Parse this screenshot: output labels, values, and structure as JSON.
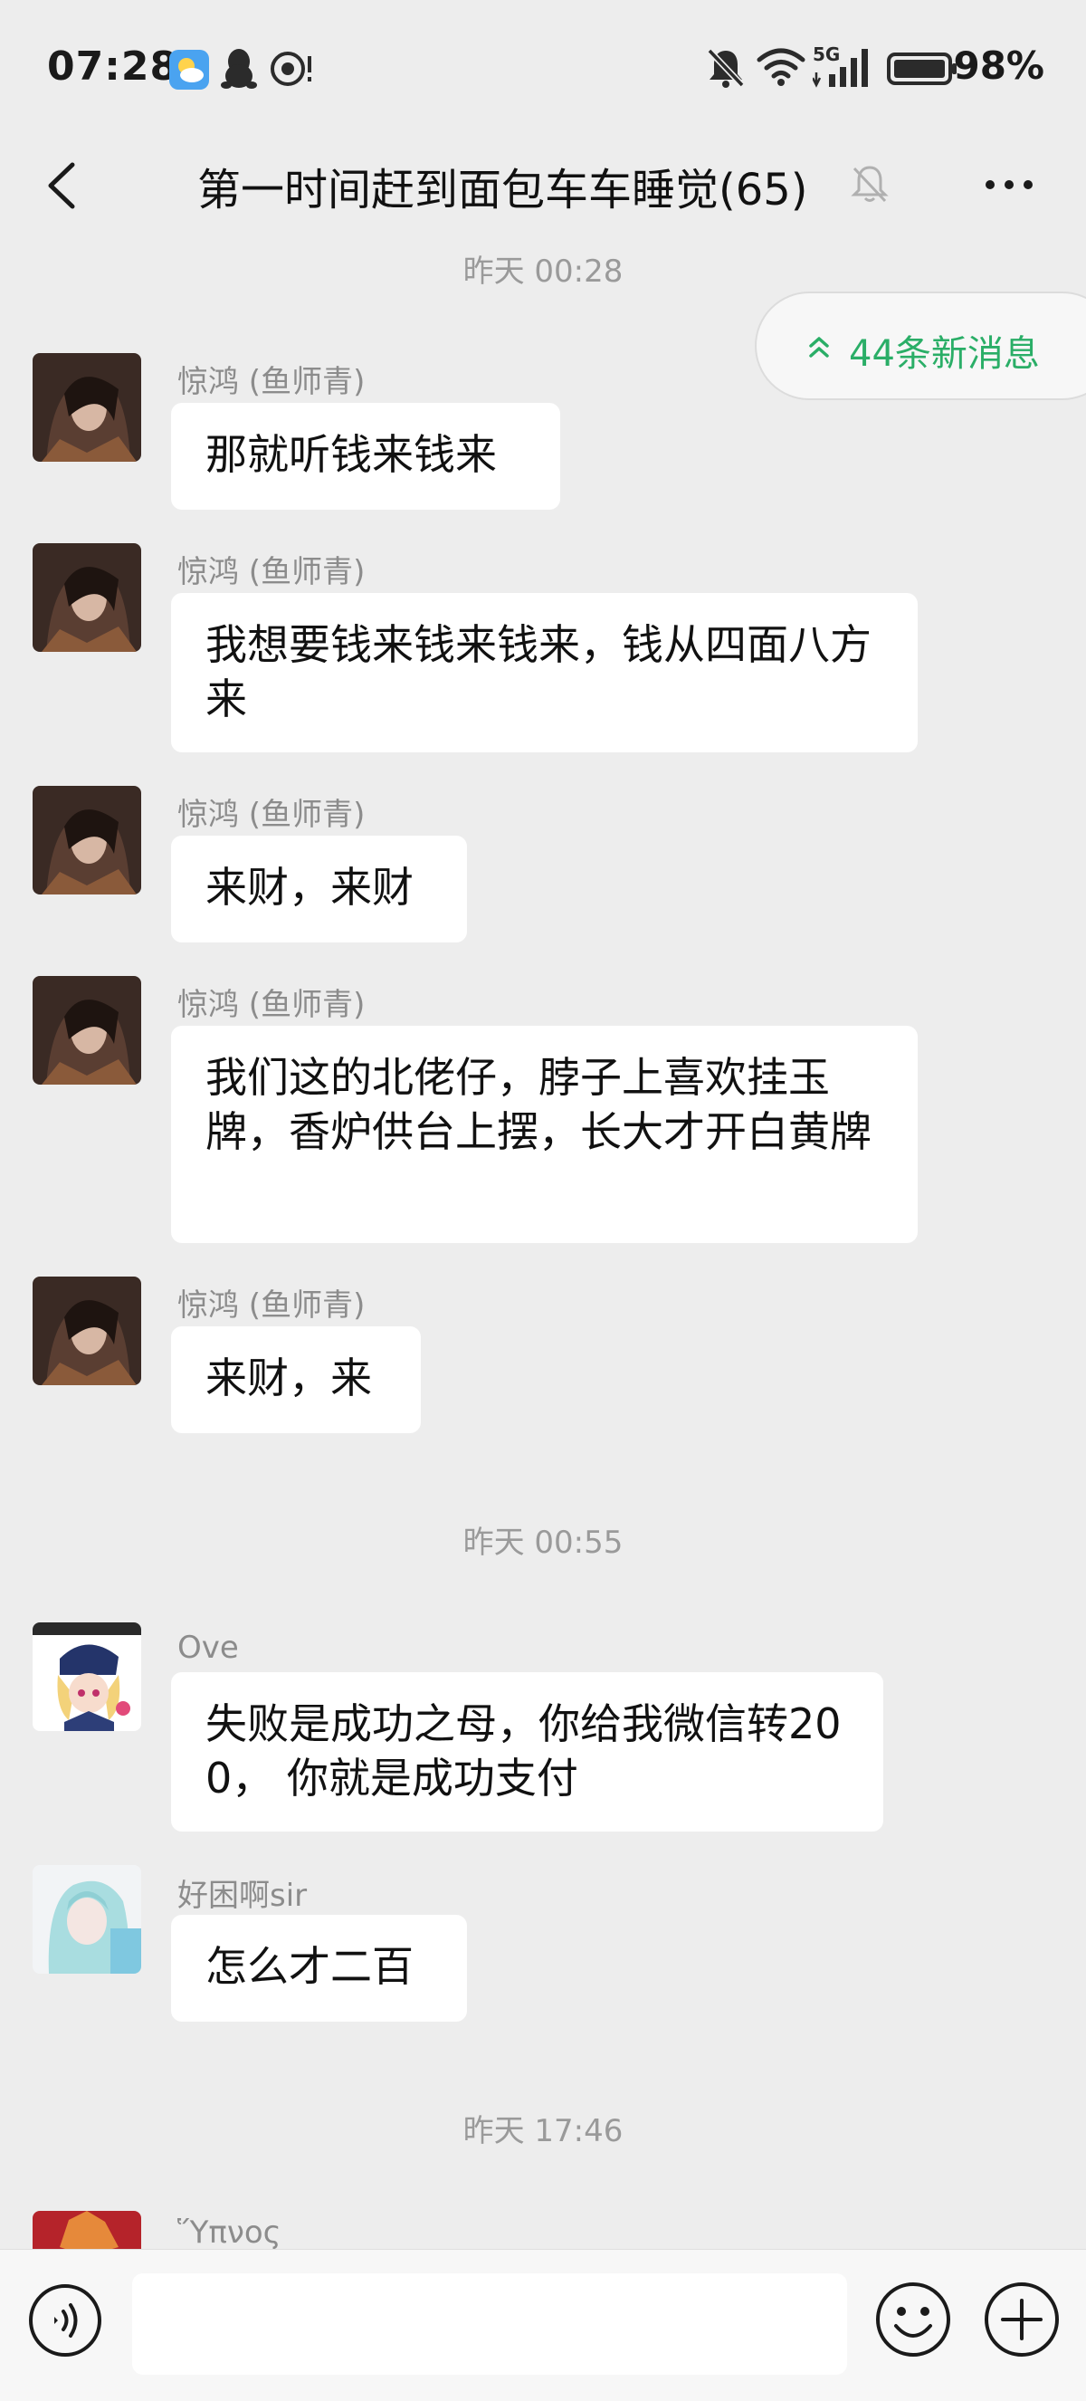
{
  "status_bar": {
    "time": "07:28",
    "network": "5G",
    "battery": "98%",
    "icons": [
      "weather-app-icon",
      "qq-icon",
      "location-icon",
      "mute-bell-icon",
      "wifi-icon",
      "signal-icon",
      "battery-icon"
    ]
  },
  "nav": {
    "title": "第一时间赶到面包车车睡觉(65)",
    "icons": [
      "back-arrow-icon",
      "mute-bell-icon",
      "more-dots-icon"
    ]
  },
  "new_messages": {
    "label": "44条新消息",
    "color": "#2aae67"
  },
  "timestamps": [
    "昨天 00:28",
    "昨天 00:55",
    "昨天 17:46"
  ],
  "messages": [
    {
      "sender": "惊鸿 (鱼师青)",
      "text": "那就听钱来钱来"
    },
    {
      "sender": "惊鸿 (鱼师青)",
      "text": "我想要钱来钱来钱来，钱从四面八方来"
    },
    {
      "sender": "惊鸿 (鱼师青)",
      "text": "来财，来财"
    },
    {
      "sender": "惊鸿 (鱼师青)",
      "text": "我们这的北佬仔，脖子上喜欢挂玉牌，香炉供台上摆，长大才开白黄牌"
    },
    {
      "sender": "惊鸿 (鱼师青)",
      "text": "来财，来"
    },
    {
      "sender": "Ove",
      "text": "失败是成功之母，你给我微信转200， 你就是成功支付"
    },
    {
      "sender": "好困啊sir",
      "text": "怎么才二百"
    },
    {
      "sender": "Ὕπνος",
      "text": ""
    }
  ],
  "input_bar": {
    "placeholder": "",
    "icons": [
      "voice-icon",
      "emoji-icon",
      "plus-icon"
    ]
  },
  "colors": {
    "background": "#ededed",
    "bubble": "#ffffff",
    "accent_green": "#2aae67"
  }
}
